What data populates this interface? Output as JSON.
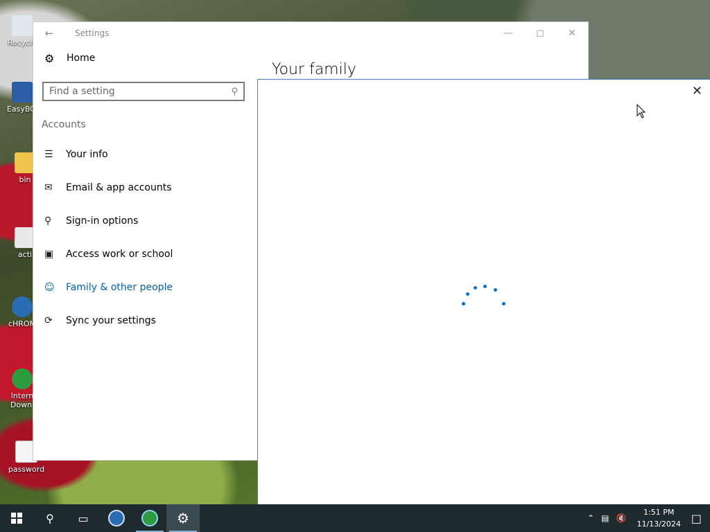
{
  "desktop": {
    "icons": [
      "Recycle",
      "EasyBCI",
      "bin",
      "acti",
      "cHROM",
      "Intern Downl",
      "password"
    ]
  },
  "settings": {
    "window_title": "Settings",
    "home_label": "Home",
    "search_placeholder": "Find a setting",
    "section": "Accounts",
    "nav": [
      {
        "label": "Your info",
        "icon": "person-card-icon"
      },
      {
        "label": "Email & app accounts",
        "icon": "mail-icon"
      },
      {
        "label": "Sign-in options",
        "icon": "key-icon"
      },
      {
        "label": "Access work or school",
        "icon": "briefcase-icon"
      },
      {
        "label": "Family & other people",
        "icon": "person-add-icon",
        "active": true
      },
      {
        "label": "Sync your settings",
        "icon": "sync-icon"
      }
    ],
    "page_title": "Your family",
    "accent_color": "#0063b1"
  },
  "dialog": {
    "state": "loading"
  },
  "taskbar": {
    "time": "1:51 PM",
    "date": "11/13/2024"
  }
}
